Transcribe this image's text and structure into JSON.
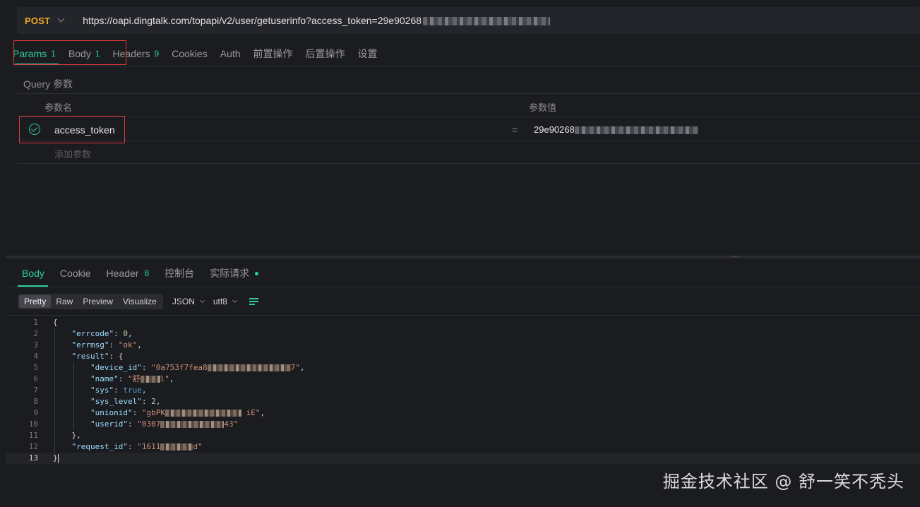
{
  "request": {
    "method": "POST",
    "url": "https://oapi.dingtalk.com/topapi/v2/user/getuserinfo?access_token=29e90268",
    "tabs": [
      {
        "label": "Params",
        "count": "1"
      },
      {
        "label": "Body",
        "count": "1"
      },
      {
        "label": "Headers",
        "count": "9"
      },
      {
        "label": "Cookies"
      },
      {
        "label": "Auth"
      },
      {
        "label": "前置操作"
      },
      {
        "label": "后置操作"
      },
      {
        "label": "设置"
      }
    ],
    "query_section": "Query 参数",
    "columns": {
      "name": "参数名",
      "value": "参数值"
    },
    "params": [
      {
        "key": "access_token",
        "value": "29e90268"
      }
    ],
    "equals": "=",
    "add_param": "添加参数"
  },
  "response": {
    "tabs": [
      {
        "label": "Body"
      },
      {
        "label": "Cookie"
      },
      {
        "label": "Header",
        "count": "8"
      },
      {
        "label": "控制台"
      },
      {
        "label": "实际请求"
      }
    ],
    "view_modes": [
      "Pretty",
      "Raw",
      "Preview",
      "Visualize"
    ],
    "format": "JSON",
    "encoding": "utf8",
    "code": {
      "open_brace": "{",
      "errcode_key": "\"errcode\"",
      "errcode_val": "0",
      "errmsg_key": "\"errmsg\"",
      "errmsg_val": "\"ok\"",
      "result_key": "\"result\"",
      "device_id_key": "\"device_id\"",
      "device_id_start": "\"0a753f7fea8",
      "device_id_end": "7\"",
      "name_key": "\"name\"",
      "name_start": "\"舒",
      "name_end": "l\"",
      "sys_key": "\"sys\"",
      "sys_val": "true",
      "sys_level_key": "\"sys_level\"",
      "sys_level_val": "2",
      "unionid_key": "\"unionid\"",
      "unionid_start": "\"gbPK",
      "unionid_end": " iE\"",
      "userid_key": "\"userid\"",
      "userid_start": "\"0307",
      "userid_end": "43\"",
      "result_close": "},",
      "request_id_key": "\"request_id\"",
      "request_id_start": "\"1611",
      "request_id_end": "d\"",
      "close_brace": "}"
    }
  },
  "watermark": "掘金技术社区 @ 舒一笑不秃头",
  "colors": {
    "accent": "#2ecc9a",
    "method": "#f5a623",
    "highlight_box": "#e0383b"
  }
}
